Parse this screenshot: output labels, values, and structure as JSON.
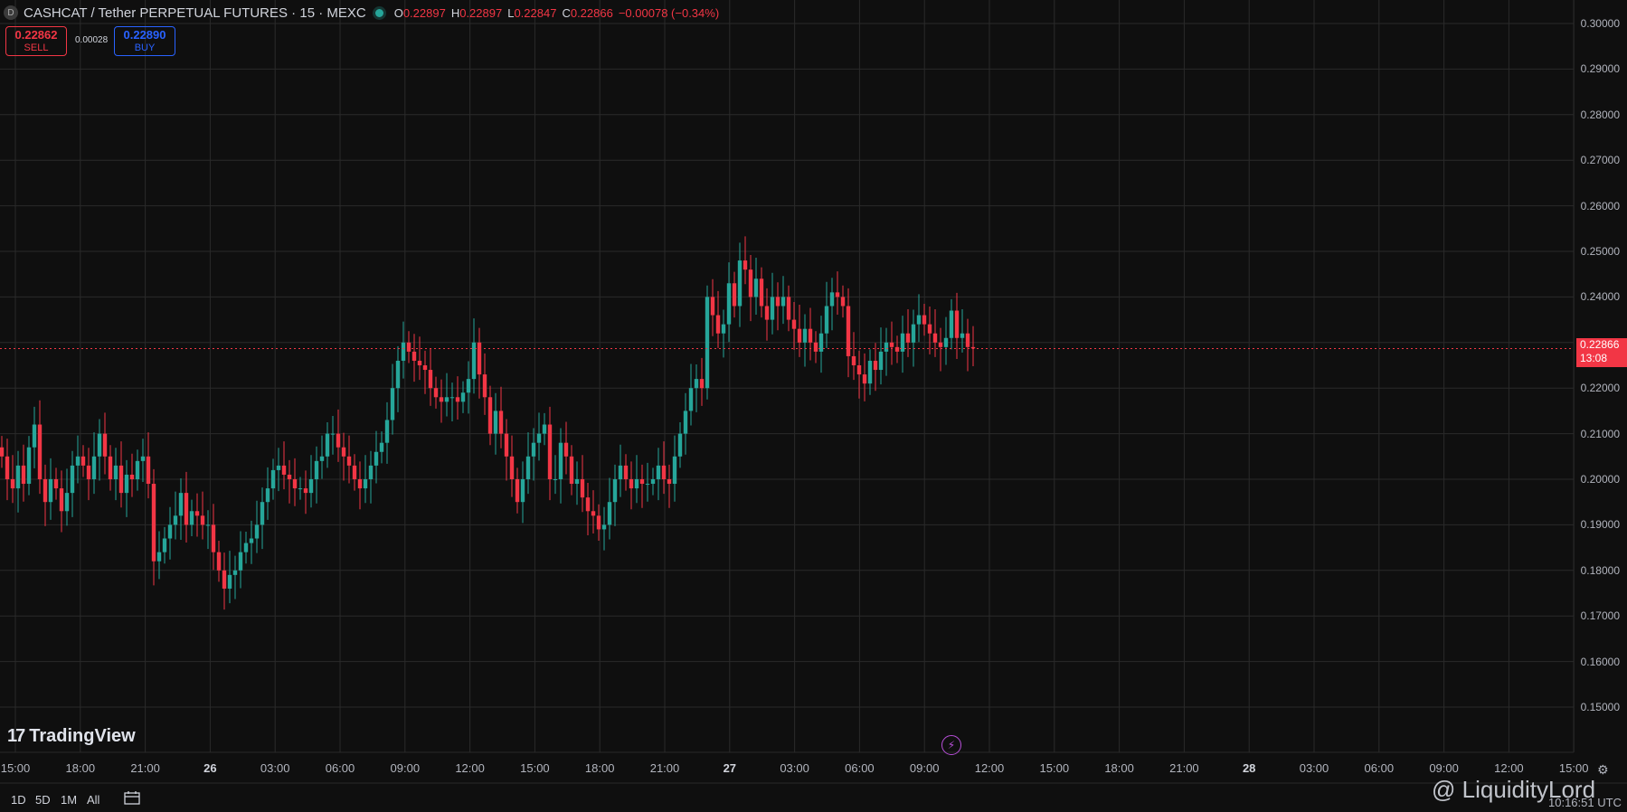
{
  "header": {
    "symbol_icon": "D",
    "title": "CASHCAT / Tether PERPETUAL FUTURES · 15 · MEXC",
    "ohlc": {
      "o_label": "O",
      "o": "0.22897",
      "h_label": "H",
      "h": "0.22897",
      "l_label": "L",
      "l": "0.22847",
      "c_label": "C",
      "c": "0.22866",
      "change": "−0.00078 (−0.34%)"
    }
  },
  "trade": {
    "sell_price": "0.22862",
    "sell_label": "SELL",
    "spread": "0.00028",
    "buy_price": "0.22890",
    "buy_label": "BUY"
  },
  "price_tag": {
    "price": "0.22866",
    "countdown": "13:08"
  },
  "brand": {
    "name": "TradingView"
  },
  "bottom": {
    "ranges": [
      "1D",
      "5D",
      "1M",
      "All"
    ],
    "clock": "10:16:51 UTC",
    "watermark": "@ LiquidityLord"
  },
  "colors": {
    "up": "#26a69a",
    "down": "#f23645",
    "grid": "#2a2a2a",
    "bg": "#0f0f0f"
  },
  "chart_data": {
    "type": "candlestick",
    "title": "CASHCAT / Tether PERPETUAL FUTURES · 15 · MEXC",
    "y_ticks": [
      "0.30000",
      "0.29000",
      "0.28000",
      "0.27000",
      "0.26000",
      "0.25000",
      "0.24000",
      "0.23000",
      "0.22000",
      "0.21000",
      "0.20000",
      "0.19000",
      "0.18000",
      "0.17000",
      "0.16000",
      "0.15000"
    ],
    "ylim": [
      0.145,
      0.3035
    ],
    "x_ticks": [
      "15:00",
      "18:00",
      "21:00",
      "26",
      "03:00",
      "06:00",
      "09:00",
      "12:00",
      "15:00",
      "18:00",
      "21:00",
      "27",
      "03:00",
      "06:00",
      "09:00",
      "12:00",
      "15:00",
      "18:00",
      "21:00",
      "28",
      "03:00",
      "06:00",
      "09:00",
      "12:00",
      "15:00"
    ],
    "bold_x_ticks": [
      "26",
      "27",
      "28"
    ],
    "last_price": 0.22866,
    "close_series": [
      0.205,
      0.2,
      0.198,
      0.203,
      0.199,
      0.207,
      0.212,
      0.2,
      0.195,
      0.2,
      0.198,
      0.193,
      0.197,
      0.203,
      0.205,
      0.203,
      0.2,
      0.205,
      0.21,
      0.205,
      0.2,
      0.203,
      0.197,
      0.201,
      0.2,
      0.204,
      0.205,
      0.199,
      0.182,
      0.184,
      0.187,
      0.19,
      0.192,
      0.197,
      0.19,
      0.193,
      0.192,
      0.19,
      0.19,
      0.184,
      0.18,
      0.176,
      0.179,
      0.18,
      0.184,
      0.186,
      0.187,
      0.19,
      0.195,
      0.198,
      0.202,
      0.203,
      0.201,
      0.2,
      0.198,
      0.198,
      0.197,
      0.2,
      0.204,
      0.205,
      0.21,
      0.21,
      0.207,
      0.205,
      0.203,
      0.2,
      0.198,
      0.2,
      0.203,
      0.206,
      0.208,
      0.213,
      0.22,
      0.226,
      0.23,
      0.228,
      0.226,
      0.225,
      0.224,
      0.22,
      0.218,
      0.217,
      0.218,
      0.218,
      0.217,
      0.219,
      0.222,
      0.23,
      0.223,
      0.218,
      0.21,
      0.215,
      0.21,
      0.205,
      0.2,
      0.195,
      0.2,
      0.205,
      0.208,
      0.21,
      0.212,
      0.2,
      0.2,
      0.208,
      0.205,
      0.199,
      0.2,
      0.196,
      0.193,
      0.192,
      0.189,
      0.19,
      0.195,
      0.2,
      0.203,
      0.2,
      0.198,
      0.2,
      0.199,
      0.199,
      0.2,
      0.203,
      0.2,
      0.199,
      0.205,
      0.21,
      0.215,
      0.22,
      0.222,
      0.22,
      0.24,
      0.236,
      0.232,
      0.234,
      0.243,
      0.238,
      0.248,
      0.246,
      0.24,
      0.244,
      0.238,
      0.235,
      0.24,
      0.238,
      0.24,
      0.235,
      0.233,
      0.23,
      0.233,
      0.23,
      0.228,
      0.232,
      0.238,
      0.241,
      0.24,
      0.238,
      0.227,
      0.225,
      0.223,
      0.221,
      0.226,
      0.224,
      0.228,
      0.23,
      0.229,
      0.228,
      0.232,
      0.23,
      0.234,
      0.236,
      0.234,
      0.232,
      0.23,
      0.229,
      0.231,
      0.237,
      0.231,
      0.232,
      0.229,
      0.2287
    ]
  }
}
